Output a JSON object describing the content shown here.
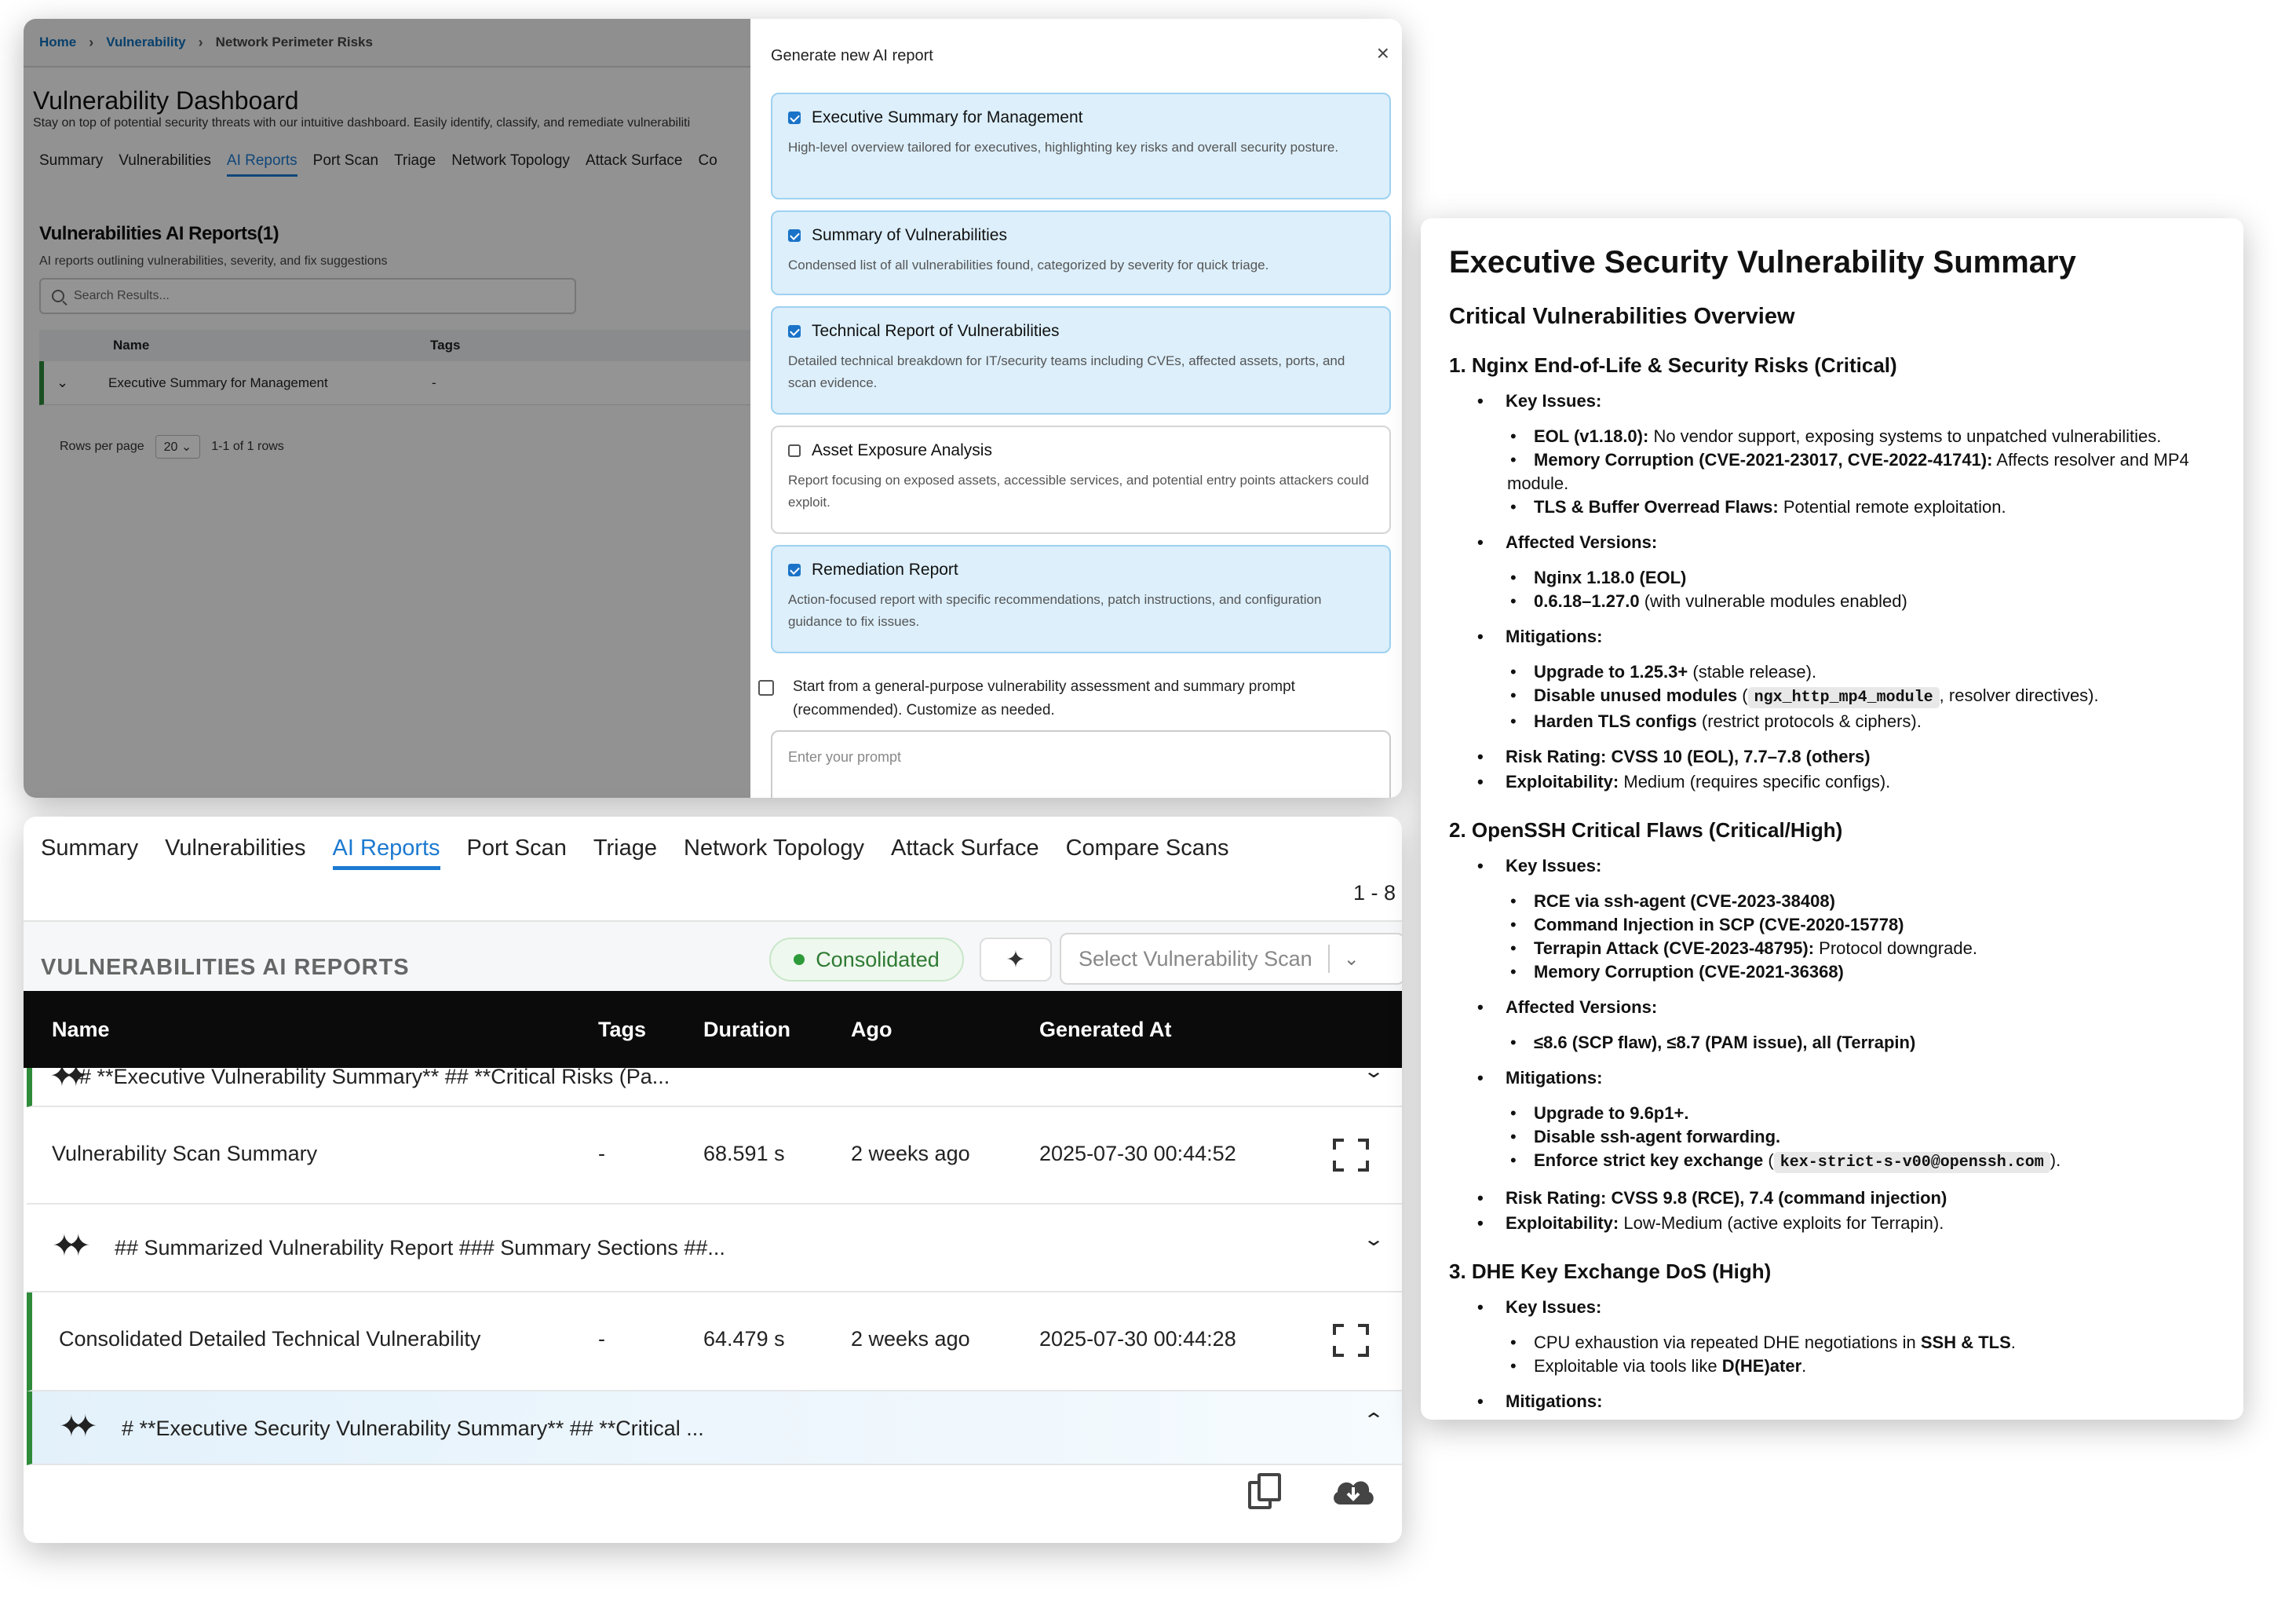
{
  "dashboard": {
    "breadcrumb": [
      "Home",
      "Vulnerability",
      "Network Perimeter Risks"
    ],
    "title": "Vulnerability Dashboard",
    "subtitle": "Stay on top of potential security threats with our intuitive dashboard. Easily identify, classify, and remediate vulnerabiliti",
    "tabs": [
      "Summary",
      "Vulnerabilities",
      "AI Reports",
      "Port Scan",
      "Triage",
      "Network Topology",
      "Attack Surface",
      "Co"
    ],
    "reports_title": "Vulnerabilities AI Reports(1)",
    "reports_subtitle": "AI reports outlining vulnerabilities, severity, and fix suggestions",
    "search_placeholder": "Search Results...",
    "columns": [
      "Name",
      "Tags"
    ],
    "row": {
      "name": "Executive Summary for Management",
      "tags": "-"
    },
    "rows_per_page_label": "Rows per page",
    "rows_per_page_value": "20",
    "rows_range": "1-1 of 1 rows"
  },
  "modal": {
    "title": "Generate new AI report",
    "close": "×",
    "options": [
      {
        "title": "Executive Summary for Management",
        "desc": "High-level overview tailored for executives, highlighting key risks and overall security posture.",
        "checked": true
      },
      {
        "title": "Summary of Vulnerabilities",
        "desc": "Condensed list of all vulnerabilities found, categorized by severity for quick triage.",
        "checked": true
      },
      {
        "title": "Technical Report of Vulnerabilities",
        "desc": "Detailed technical breakdown for IT/security teams including CVEs, affected assets, ports, and scan evidence.",
        "checked": true
      },
      {
        "title": "Asset Exposure Analysis",
        "desc": "Report focusing on exposed assets, accessible services, and potential entry points attackers could exploit.",
        "checked": false
      },
      {
        "title": "Remediation Report",
        "desc": "Action-focused report with specific recommendations, patch instructions, and configuration guidance to fix issues.",
        "checked": true
      }
    ],
    "general_prompt_label": "Start from a general-purpose vulnerability assessment and summary prompt (recommended). Customize as needed.",
    "prompt_placeholder": "Enter your prompt"
  },
  "reports": {
    "tabs": [
      "Summary",
      "Vulnerabilities",
      "AI Reports",
      "Port Scan",
      "Triage",
      "Network Topology",
      "Attack Surface",
      "Compare Scans"
    ],
    "range": "1 - 8",
    "section_title": "VULNERABILITIES AI REPORTS",
    "badge": "Consolidated",
    "sparkle_glyph": "✦",
    "scan_select_placeholder": "Select Vulnerability Scan",
    "columns": [
      "Name",
      "Tags",
      "Duration",
      "Ago",
      "Generated At"
    ],
    "partial_summary": "# **Executive Vulnerability Summary** ## **Critical Risks (Pa...",
    "rows": [
      {
        "name": "Vulnerability Scan Summary",
        "tags": "-",
        "duration": "68.591 s",
        "ago": "2 weeks ago",
        "generated": "2025-07-30 00:44:52"
      },
      {
        "summary": "## Summarized Vulnerability Report ### Summary Sections ##..."
      },
      {
        "name": "Consolidated Detailed Technical Vulnerability",
        "tags": "-",
        "duration": "64.479 s",
        "ago": "2 weeks ago",
        "generated": "2025-07-30 00:44:28"
      },
      {
        "summary": "# **Executive Security Vulnerability Summary** ## **Critical ..."
      }
    ]
  },
  "doc": {
    "title": "Executive Security Vulnerability Summary",
    "overview": "Critical Vulnerabilities Overview",
    "s1": {
      "heading": "1. Nginx End-of-Life & Security Risks (Critical)",
      "key_issues": "Key Issues:",
      "i1b": "EOL (v1.18.0):",
      "i1": " No vendor support, exposing systems to unpatched vulnerabilities.",
      "i2b": "Memory Corruption (CVE-2021-23017, CVE-2022-41741):",
      "i2": " Affects resolver and MP4 module.",
      "i3b": "TLS & Buffer Overread Flaws:",
      "i3": " Potential remote exploitation.",
      "affected": "Affected Versions:",
      "a1": "Nginx 1.18.0 (EOL)",
      "a2b": "0.6.18–1.27.0",
      "a2": " (with vulnerable modules enabled)",
      "mitigations": "Mitigations:",
      "m1b": "Upgrade to 1.25.3+",
      "m1": " (stable release).",
      "m2b": "Disable unused modules",
      "m2pre": " (",
      "m2code": "ngx_http_mp4_module",
      "m2": ", resolver directives).",
      "m3b": "Harden TLS configs",
      "m3": " (restrict protocols & ciphers).",
      "risk": "Risk Rating: CVSS 10 (EOL), 7.7–7.8 (others)",
      "expl_b": "Exploitability:",
      "expl": " Medium (requires specific configs)."
    },
    "s2": {
      "heading": "2. OpenSSH Critical Flaws (Critical/High)",
      "key_issues": "Key Issues:",
      "i1": "RCE via ssh-agent (CVE-2023-38408)",
      "i2": "Command Injection in SCP (CVE-2020-15778)",
      "i3b": "Terrapin Attack (CVE-2023-48795):",
      "i3": " Protocol downgrade.",
      "i4": "Memory Corruption (CVE-2021-36368)",
      "affected": "Affected Versions:",
      "a1": "≤8.6 (SCP flaw), ≤8.7 (PAM issue), all (Terrapin)",
      "mitigations": "Mitigations:",
      "m1": "Upgrade to 9.6p1+.",
      "m2": "Disable ssh-agent forwarding.",
      "m3b": "Enforce strict key exchange",
      "m3pre": " (",
      "m3code": "kex-strict-s-v00@openssh.com",
      "m3": ").",
      "risk": "Risk Rating: CVSS 9.8 (RCE), 7.4 (command injection)",
      "expl_b": "Exploitability:",
      "expl": " Low-Medium (active exploits for Terrapin)."
    },
    "s3": {
      "heading": "3. DHE Key Exchange DoS (High)",
      "key_issues": "Key Issues:",
      "i1": "CPU exhaustion via repeated DHE negotiations in ",
      "i1b": "SSH & TLS",
      "i1end": ".",
      "i2": "Exploitable via tools like ",
      "i2b": "D(HE)ater",
      "i2end": ".",
      "mitigations": "Mitigations:"
    }
  }
}
